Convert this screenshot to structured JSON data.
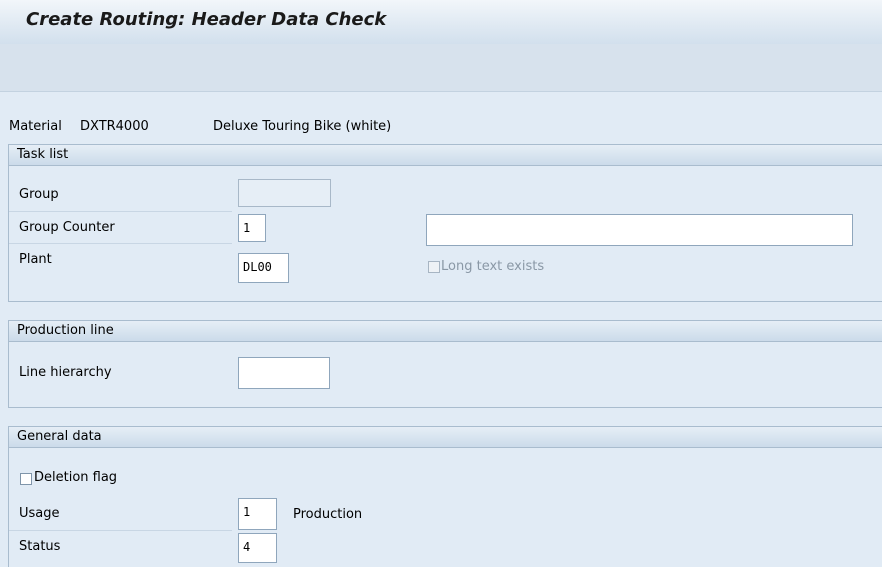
{
  "window": {
    "title": "Create Routing: Header Data Check"
  },
  "material": {
    "label": "Material",
    "code": "DXTR4000",
    "description": "Deluxe Touring Bike (white)"
  },
  "task_list": {
    "section_title": "Task list",
    "group_label": "Group",
    "group_value": "",
    "group_counter_label": "Group Counter",
    "group_counter_value": "1",
    "description_value": "",
    "plant_label": "Plant",
    "plant_value": "DL00",
    "long_text_label": "Long text exists",
    "long_text_checked": false
  },
  "production_line": {
    "section_title": "Production line",
    "line_hierarchy_label": "Line hierarchy",
    "line_hierarchy_value": ""
  },
  "general_data": {
    "section_title": "General data",
    "deletion_flag_label": "Deletion flag",
    "deletion_flag_checked": false,
    "usage_label": "Usage",
    "usage_value": "1",
    "usage_text": "Production",
    "status_label": "Status",
    "status_value": "4"
  }
}
